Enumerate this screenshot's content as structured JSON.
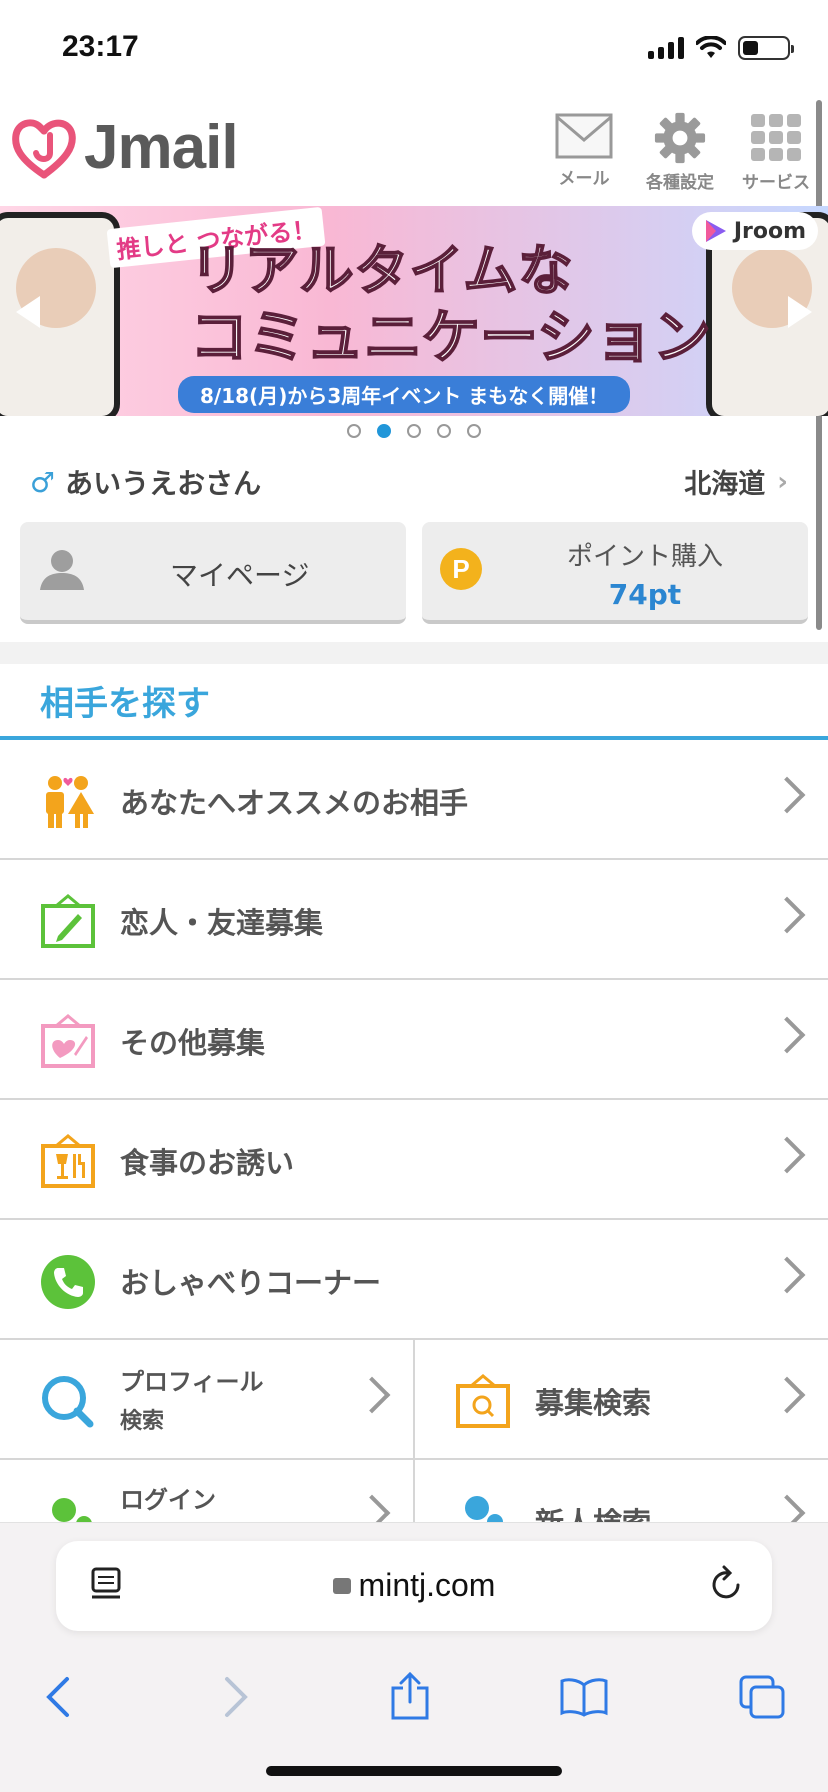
{
  "status_bar": {
    "time": "23:17"
  },
  "header": {
    "brand": "Jmail",
    "nav": [
      {
        "label": "メール",
        "icon": "mail-icon"
      },
      {
        "label": "各種設定",
        "icon": "gear-icon"
      },
      {
        "label": "サービス",
        "icon": "grid-icon"
      }
    ]
  },
  "banner": {
    "tag": "推しと つながる！",
    "title_line1": "リアルタイムな",
    "title_line2": "コミュニケーション",
    "subtitle": "8/18(月)から3周年イベント まもなく開催！",
    "partner": "Jroom",
    "slide_count": 5,
    "active_slide": 2
  },
  "user": {
    "name": "あいうえおさん",
    "region": "北海道"
  },
  "actions": {
    "mypage": "マイページ",
    "points_label": "ポイント購入",
    "points_value": "74pt"
  },
  "section": {
    "title": "相手を探す"
  },
  "menu": [
    {
      "label": "あなたへオススメのお相手",
      "icon": "couple-icon"
    },
    {
      "label": "恋人・友達募集",
      "icon": "board-pencil-icon"
    },
    {
      "label": "その他募集",
      "icon": "board-heart-icon"
    },
    {
      "label": "食事のお誘い",
      "icon": "board-meal-icon"
    },
    {
      "label": "おしゃべりコーナー",
      "icon": "phone-icon"
    }
  ],
  "grid": [
    {
      "label_line1": "プロフィール",
      "label_line2": "検索",
      "icon": "magnifier-icon"
    },
    {
      "label_line1": "募集検索",
      "icon": "board-search-icon"
    },
    {
      "label_line1": "ログイン",
      "icon": "login-icon"
    },
    {
      "label_line1": "新人検索",
      "icon": "new-member-icon"
    }
  ],
  "browser": {
    "url": "mintj.com"
  },
  "colors": {
    "accent": "#3aa6dc",
    "points": "#2b86d1",
    "coin": "#f3b21c"
  }
}
